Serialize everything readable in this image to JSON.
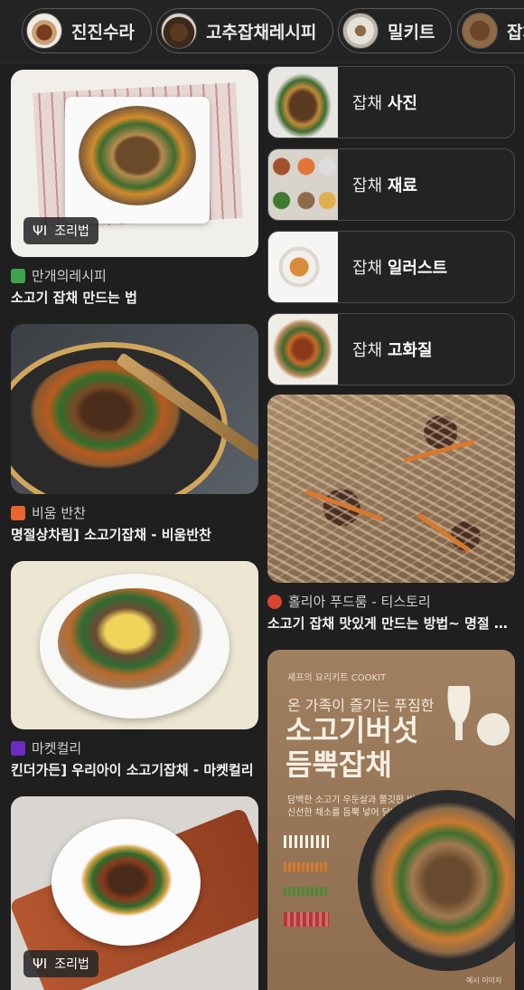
{
  "chips": [
    {
      "label": "진진수라",
      "icon": "food-thumbnail"
    },
    {
      "label": "고추잡채레시피",
      "icon": "food-thumbnail"
    },
    {
      "label": "밀키트",
      "icon": "food-thumbnail"
    },
    {
      "label": "잡채",
      "icon": "food-thumbnail"
    }
  ],
  "left_results": [
    {
      "source": "만개의레시피",
      "title": "소고기 잡채 만드는 법",
      "badge": "조리법",
      "favicon_color": "#3fa34d"
    },
    {
      "source": "비움 반찬",
      "title": "명절상차림] 소고기잡채 - 비움반찬",
      "favicon_color": "#e8652e"
    },
    {
      "source": "마켓컬리",
      "title": "킨더가든] 우리아이 소고기잡채 - 마켓컬리",
      "favicon_color": "#6a2cc2"
    },
    {
      "badge": "조리법"
    }
  ],
  "related": [
    {
      "prefix": "잡채 ",
      "bold": "사진"
    },
    {
      "prefix": "잡채 ",
      "bold": "재료"
    },
    {
      "prefix": "잡채 ",
      "bold": "일러스트"
    },
    {
      "prefix": "잡채 ",
      "bold": "고화질"
    }
  ],
  "right_results": [
    {
      "source": "홀리아 푸드룸 - 티스토리",
      "title": "소고기 잡채 맛있게 만드는 방법~ 명절 소...",
      "favicon_color": "#d9452f"
    },
    {
      "poster_brand": "셰프의 요리키트 COOKIT",
      "poster_sub": "온 가족이 즐기는 푸짐한",
      "poster_title_1": "소고기버섯",
      "poster_title_2": "듬뿍잡채",
      "poster_desc_1": "담백한 소고기 우둔살과 쫄깃한 버섯",
      "poster_desc_2": "신선한 채소를 듬뿍 넣어 담백한 잡채",
      "poster_footer": "예시 이미지"
    }
  ]
}
